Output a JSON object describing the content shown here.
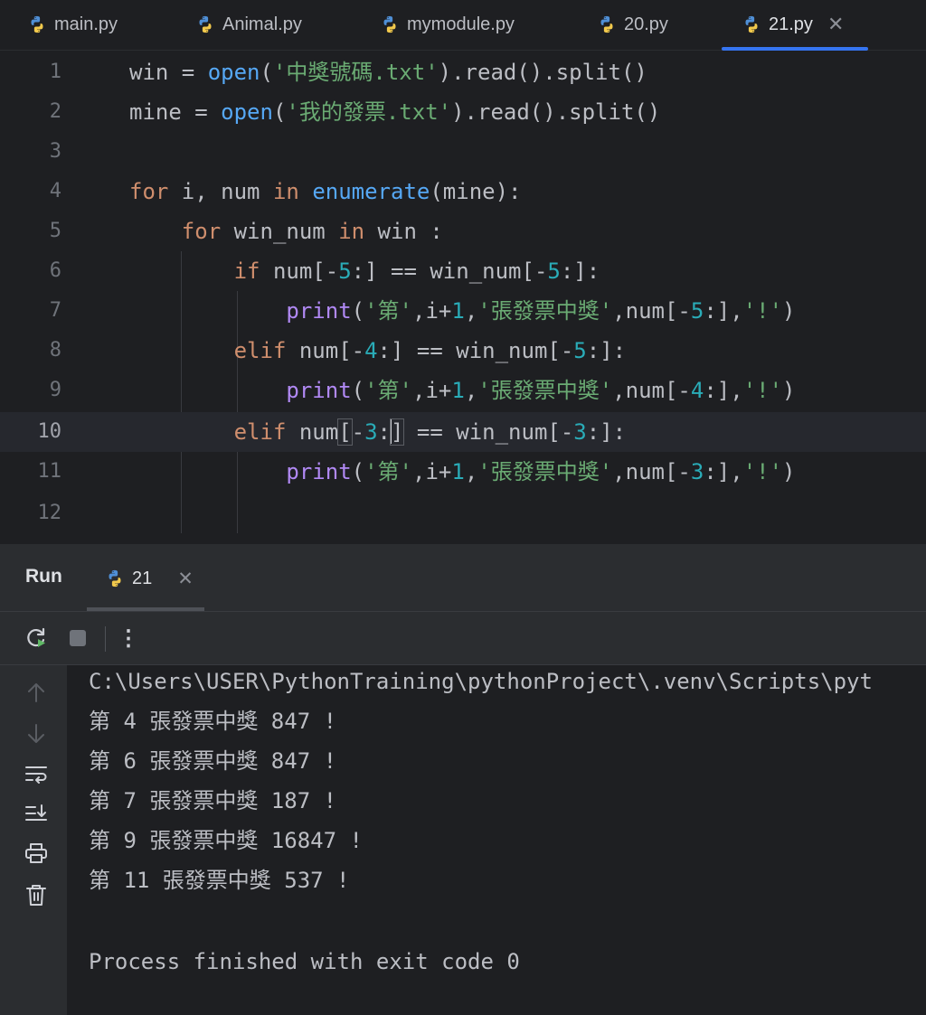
{
  "tabs": [
    {
      "label": "main.py",
      "icon": "python-icon",
      "active": false
    },
    {
      "label": "Animal.py",
      "icon": "python-icon",
      "active": false
    },
    {
      "label": "mymodule.py",
      "icon": "python-icon",
      "active": false
    },
    {
      "label": "20.py",
      "icon": "python-icon",
      "active": false
    },
    {
      "label": "21.py",
      "icon": "python-icon",
      "active": true,
      "close": "✕"
    }
  ],
  "editor": {
    "current_line": 10,
    "line_numbers": [
      "1",
      "2",
      "3",
      "4",
      "5",
      "6",
      "7",
      "8",
      "9",
      "10",
      "11",
      "12"
    ],
    "code_lines": [
      "win = open('中獎號碼.txt').read().split()",
      "mine = open('我的發票.txt').read().split()",
      "",
      "for i, num in enumerate(mine):",
      "    for win_num in win :",
      "        if num[-5:] == win_num[-5:]:",
      "            print('第',i+1,'張發票中獎',num[-5:],'!')",
      "        elif num[-4:] == win_num[-5:]:",
      "            print('第',i+1,'張發票中獎',num[-4:],'!')",
      "        elif num[-3:] == win_num[-3:]:",
      "            print('第',i+1,'張發票中獎',num[-3:],'!')",
      ""
    ]
  },
  "run_panel": {
    "title": "Run",
    "tab_label": "21",
    "tab_close": "✕",
    "toolbar": {
      "rerun_icon": "rerun-icon",
      "stop_icon": "stop-icon",
      "more": "⋮"
    },
    "side_icons": [
      "arrow-up-icon",
      "arrow-down-icon",
      "soft-wrap-icon",
      "scroll-to-end-icon",
      "print-icon",
      "trash-icon"
    ],
    "output": [
      "C:\\Users\\USER\\PythonTraining\\pythonProject\\.venv\\Scripts\\pyt",
      "第 4 張發票中獎 847 !",
      "第 6 張發票中獎 847 !",
      "第 7 張發票中獎 187 !",
      "第 9 張發票中獎 16847 !",
      "第 11 張發票中獎 537 !",
      "",
      "Process finished with exit code 0"
    ]
  },
  "colors": {
    "background": "#1e1f22",
    "panel": "#2b2d30",
    "keyword": "#cf8e6d",
    "function": "#56a8f5",
    "string": "#6aab73",
    "number": "#2aacb8",
    "accent": "#3574f0"
  }
}
